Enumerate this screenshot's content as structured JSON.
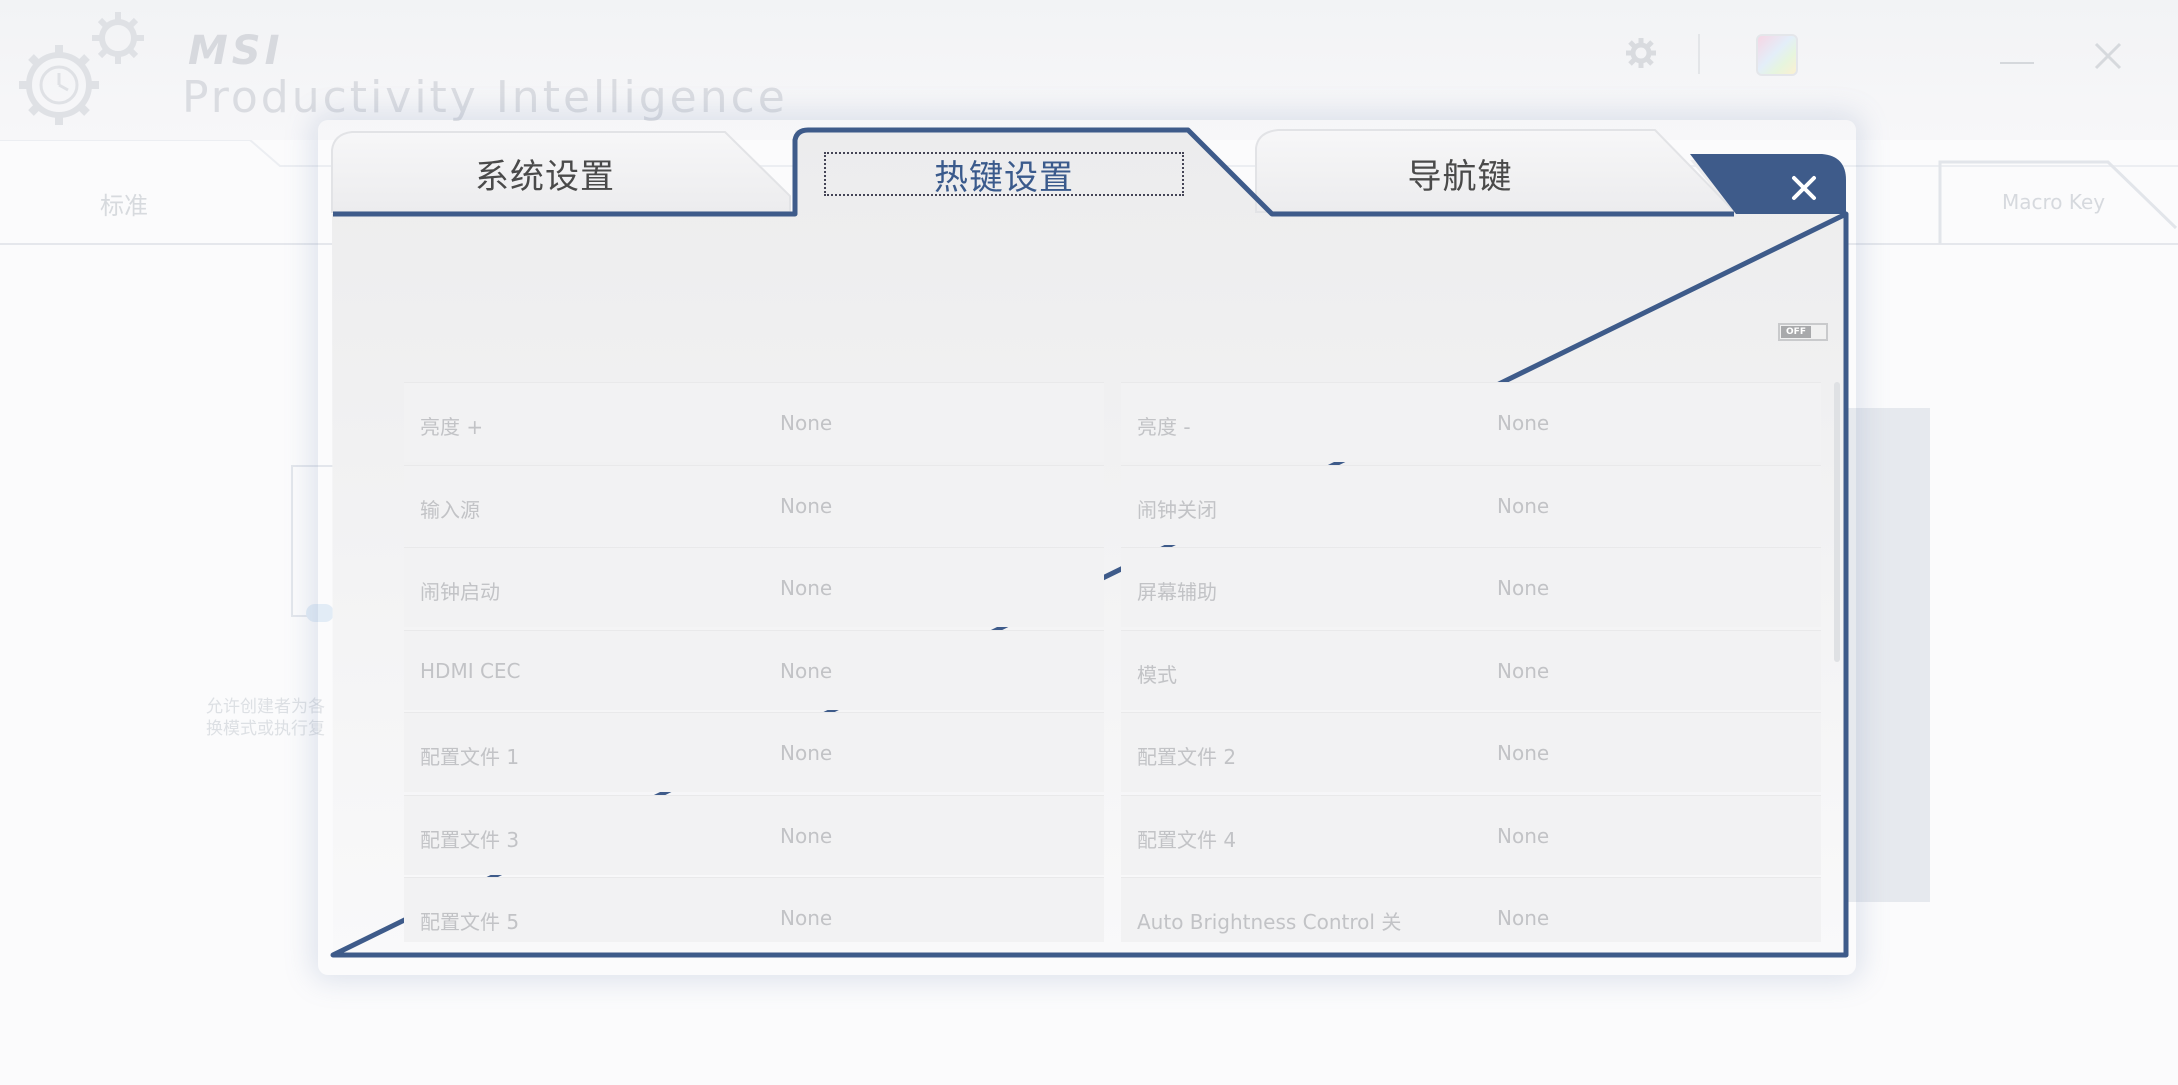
{
  "background_app": {
    "brand": "MSI",
    "product_name": "Productivity Intelligence",
    "tab_standard": "标准",
    "tab_macro_key": "Macro Key",
    "description_line1": "允许创建者为各",
    "description_line2": "换模式或执行复"
  },
  "dialog": {
    "tabs": [
      {
        "label": "系统设置"
      },
      {
        "label": "热键设置"
      },
      {
        "label": "导航键"
      }
    ],
    "active_tab_index": 1,
    "toggle_label": "OFF",
    "rows": [
      {
        "left": {
          "name": "亮度 +",
          "value": "None"
        },
        "right": {
          "name": "亮度 -",
          "value": "None"
        }
      },
      {
        "left": {
          "name": "输入源",
          "value": "None"
        },
        "right": {
          "name": "闹钟关闭",
          "value": "None"
        }
      },
      {
        "left": {
          "name": "闹钟启动",
          "value": "None"
        },
        "right": {
          "name": "屏幕辅助",
          "value": "None"
        }
      },
      {
        "left": {
          "name": "HDMI CEC",
          "value": "None"
        },
        "right": {
          "name": "模式",
          "value": "None"
        }
      },
      {
        "left": {
          "name": "配置文件 1",
          "value": "None"
        },
        "right": {
          "name": "配置文件 2",
          "value": "None"
        }
      },
      {
        "left": {
          "name": "配置文件 3",
          "value": "None"
        },
        "right": {
          "name": "配置文件 4",
          "value": "None"
        }
      },
      {
        "left": {
          "name": "配置文件 5",
          "value": "None"
        },
        "right": {
          "name": "Auto Brightness Control 关",
          "value": "None"
        }
      }
    ]
  },
  "colors": {
    "dialog_border": "#3e5b8a",
    "active_tab_text": "#3a5a8c"
  }
}
